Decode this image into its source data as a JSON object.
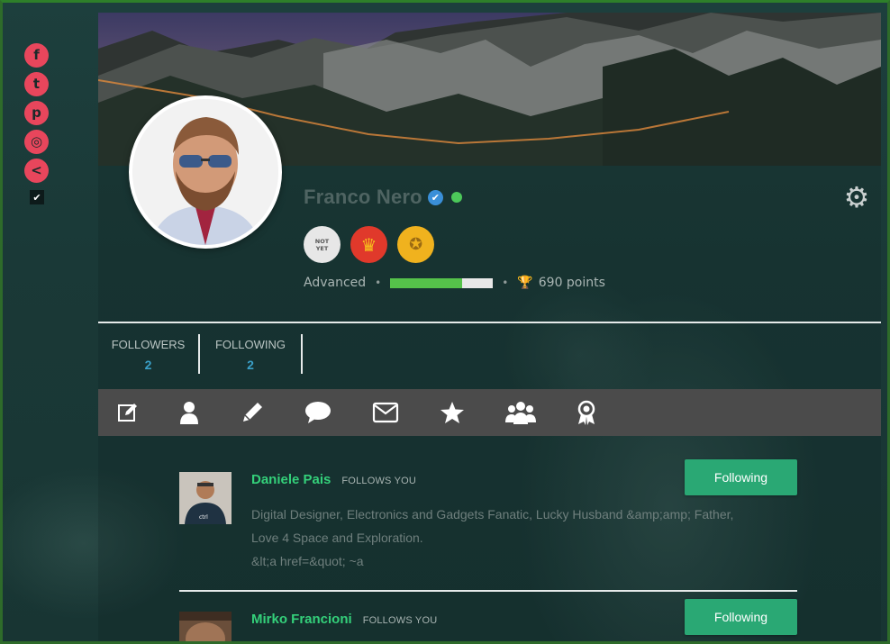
{
  "social": {
    "items": [
      {
        "name": "facebook",
        "glyph": "f"
      },
      {
        "name": "twitter",
        "glyph": "t"
      },
      {
        "name": "pinterest",
        "glyph": "p"
      },
      {
        "name": "instagram",
        "glyph": "◎"
      },
      {
        "name": "share",
        "glyph": "<"
      }
    ],
    "extra_glyph": "✔"
  },
  "profile": {
    "name": "Franco Nero",
    "verified_glyph": "✔",
    "settings_glyph": "⚙",
    "badges": {
      "not_yet_line1": "NOT",
      "not_yet_line2": "YET",
      "crown_glyph": "♛",
      "medal_glyph": "✪"
    },
    "level": "Advanced",
    "progress_fraction": 0.7,
    "points_text": "690 points",
    "trophy_glyph": "🏆"
  },
  "stats": {
    "followers_label": "FOLLOWERS",
    "followers_value": "2",
    "following_label": "FOLLOWING",
    "following_value": "2"
  },
  "toolbar": {
    "icons": [
      "edit-icon",
      "user-icon",
      "pencil-icon",
      "comment-icon",
      "envelope-icon",
      "star-icon",
      "group-icon",
      "award-icon"
    ]
  },
  "followers": [
    {
      "name": "Daniele Pais",
      "follows_label": "FOLLOWS YOU",
      "button_label": "Following",
      "bio_line1": "Digital Designer, Electronics and Gadgets Fanatic, Lucky Husband &amp;amp; Father,",
      "bio_line2": "Love 4 Space and Exploration.",
      "bio_line3": "&lt;a href=&quot; ~a"
    },
    {
      "name": "Mirko Francioni",
      "follows_label": "FOLLOWS YOU",
      "button_label": "Following"
    }
  ],
  "colors": {
    "accent_green": "#34d07a",
    "button_green": "#2aa874",
    "social_red": "#e8465c",
    "stat_blue": "#3aa0c8"
  }
}
